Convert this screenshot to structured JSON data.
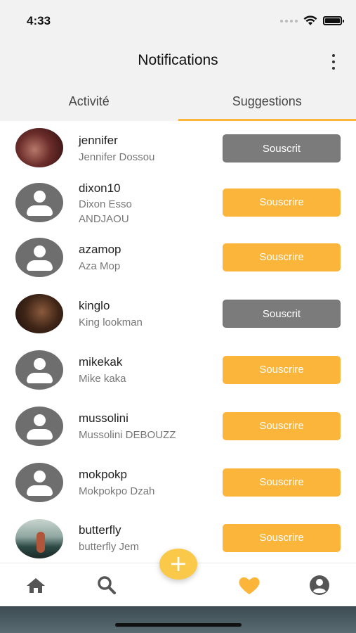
{
  "status_bar": {
    "time": "4:33"
  },
  "header": {
    "title": "Notifications"
  },
  "tabs": [
    {
      "label": "Activité",
      "active": false
    },
    {
      "label": "Suggestions",
      "active": true
    }
  ],
  "suggestions": [
    {
      "username": "jennifer",
      "fullname": "Jennifer  Dossou",
      "button": "Souscrit",
      "subscribed": true
    },
    {
      "username": "dixon10",
      "fullname": "Dixon Esso ANDJAOU",
      "button": "Souscrire",
      "subscribed": false
    },
    {
      "username": "azamop",
      "fullname": "Aza Mop",
      "button": "Souscrire",
      "subscribed": false
    },
    {
      "username": "kinglo",
      "fullname": "King  lookman",
      "button": "Souscrit",
      "subscribed": true
    },
    {
      "username": "mikekak",
      "fullname": "Mike kaka",
      "button": "Souscrire",
      "subscribed": false
    },
    {
      "username": "mussolini",
      "fullname": "Mussolini DEBOUZZ",
      "button": "Souscrire",
      "subscribed": false
    },
    {
      "username": "mokpokp",
      "fullname": "Mokpokpo Dzah",
      "button": "Souscrire",
      "subscribed": false
    },
    {
      "username": "butterfly",
      "fullname": "butterfly  Jem",
      "button": "Souscrire",
      "subscribed": false
    }
  ],
  "fab": {
    "label": "+"
  },
  "colors": {
    "accent": "#fbb53a",
    "subscribed": "#7b7b7b",
    "icon": "#555555"
  }
}
